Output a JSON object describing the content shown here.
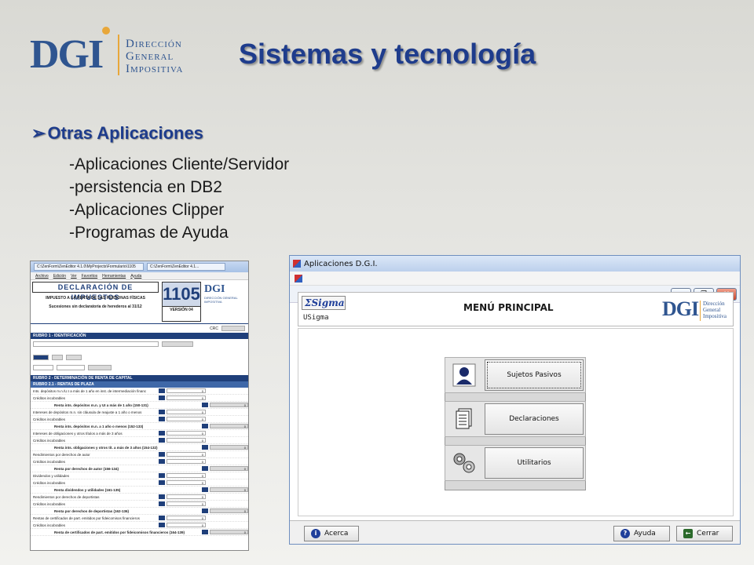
{
  "logo": {
    "dgi": "DGI",
    "lines": [
      "Dirección",
      "General",
      "Impositiva"
    ]
  },
  "title": "Sistemas y tecnología",
  "section": {
    "heading": "Otras Aplicaciones",
    "items": [
      "-Aplicaciones Cliente/Servidor",
      "-persistencia en DB2",
      "-Aplicaciones Clipper",
      "-Programas de Ayuda"
    ]
  },
  "form_shot": {
    "tabs": [
      "C:\\ZenForm\\ZenEditor 4.1.0\\MyProjects\\Formulario\\1105",
      "C:\\ZenForm\\ZenEditor 4.1..."
    ],
    "menu": [
      "Archivo",
      "Edición",
      "Ver",
      "Favoritos",
      "Herramientas",
      "Ayuda"
    ],
    "declaracion": "DECLARACIÓN DE IMPUESTOS",
    "impuesto": "IMPUESTO A LA RENTA DE LAS PERSONAS FÍSICAS",
    "sucesiones": "Sucesiones sin declaratoria de herederos al 31/12",
    "form_number": "1105",
    "version": "VERSIÓN 04",
    "logo": "DGI",
    "logo_sub": "DIRECCIÓN GENERAL IMPOSITIVA",
    "crc": "CRC",
    "rubro1": "RUBRO 1 - IDENTIFICACIÓN",
    "rubro2": "RUBRO 2 - DETERMINACIÓN DE RENTA DE CAPITAL",
    "rubro21": "RUBRO 2.1 - RENTAS DE PLAZA",
    "rows": [
      {
        "label": "Ints. depósitos m.n./U.I a más de 1 año en inst. de intermediación financ",
        "value": "0",
        "total": false
      },
      {
        "label": "Créditos incobrables",
        "value": "0",
        "total": false
      },
      {
        "label": "Renta ints. depósitos m.n. y UI a más de 1 año (150-131)",
        "value": "0",
        "total": true
      },
      {
        "label": "Intereses de depósitos m.n. sin cláusula de reajuste a 1 año o menos",
        "value": "0",
        "total": false
      },
      {
        "label": "Créditos incobrables",
        "value": "0",
        "total": false
      },
      {
        "label": "Renta ints. depósitos m.n. a 1 año o menos (152-133)",
        "value": "0",
        "total": true
      },
      {
        "label": "Intereses de obligaciones y otros títulos a más de 3 años",
        "value": "0",
        "total": false
      },
      {
        "label": "Créditos incobrables",
        "value": "0",
        "total": false
      },
      {
        "label": "Renta ints. obligaciones y otros tít. a más de 3 años (154-132)",
        "value": "0",
        "total": true
      },
      {
        "label": "Rendimientos por derechos de autor",
        "value": "0",
        "total": false
      },
      {
        "label": "Créditos incobrables",
        "value": "0",
        "total": false
      },
      {
        "label": "Renta por derechos de autor (156-134)",
        "value": "0",
        "total": true
      },
      {
        "label": "Dividendos y utilidades",
        "value": "0",
        "total": false
      },
      {
        "label": "Créditos incobrables",
        "value": "0",
        "total": false
      },
      {
        "label": "Renta dividendos y utilidades (161-135)",
        "value": "0",
        "total": true
      },
      {
        "label": "Rendimientos por derechos de deportistas",
        "value": "0",
        "total": false
      },
      {
        "label": "Créditos incobrables",
        "value": "0",
        "total": false
      },
      {
        "label": "Renta por derechos de deportistas (162-136)",
        "value": "0",
        "total": true
      },
      {
        "label": "Rentas de certificados de part. emitidos por fideicomisos financieros",
        "value": "0",
        "total": false
      },
      {
        "label": "Créditos incobrables",
        "value": "0",
        "total": false
      },
      {
        "label": "Renta de certificados de part. emitidos por fideicomisos financieros (164-139)",
        "value": "0",
        "total": true
      }
    ]
  },
  "app": {
    "title": "Aplicaciones  D.G.I.",
    "win_buttons": [
      "minimize",
      "restore",
      "close"
    ],
    "sigma": "Sigma",
    "usigma": "USigma",
    "menu_title": "MENÚ PRINCIPAL",
    "dgi": "DGI",
    "dgi_lines": [
      "Dirección",
      "General",
      "Impositiva"
    ],
    "menu_items": [
      "Sujetos Pasivos",
      "Declaraciones",
      "Utilitarios"
    ],
    "footer": {
      "acerca": "Acerca",
      "ayuda": "Ayuda",
      "cerrar": "Cerrar"
    }
  },
  "colors": {
    "title": "#1e3c8c",
    "brand_blue": "#2f5590",
    "brand_gold": "#e8a73a"
  }
}
